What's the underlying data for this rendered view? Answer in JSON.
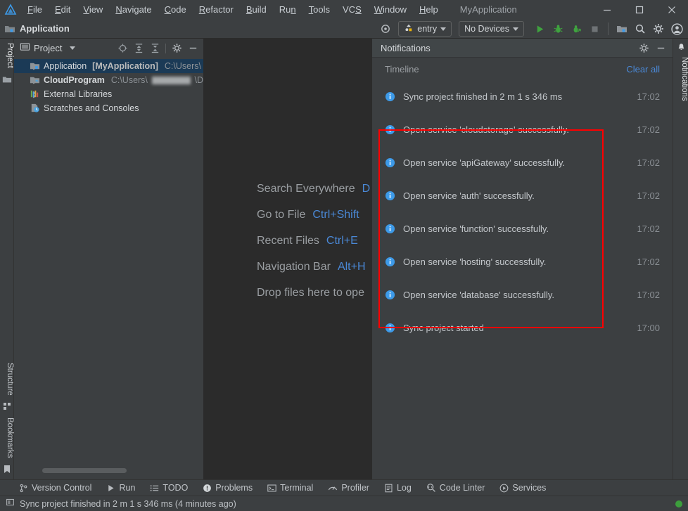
{
  "window": {
    "title": "MyApplication",
    "logo_icon": "ide-logo-icon",
    "minimize_icon": "window-minimize-icon",
    "maximize_icon": "window-maximize-icon",
    "close_icon": "window-close-icon"
  },
  "menubar": {
    "items": [
      {
        "label": "File",
        "mnemonic": "F"
      },
      {
        "label": "Edit",
        "mnemonic": "E"
      },
      {
        "label": "View",
        "mnemonic": "V"
      },
      {
        "label": "Navigate",
        "mnemonic": "N"
      },
      {
        "label": "Code",
        "mnemonic": "C"
      },
      {
        "label": "Refactor",
        "mnemonic": "R"
      },
      {
        "label": "Build",
        "mnemonic": "B"
      },
      {
        "label": "Run",
        "mnemonic": "n"
      },
      {
        "label": "Tools",
        "mnemonic": "T"
      },
      {
        "label": "VCS",
        "mnemonic": "S"
      },
      {
        "label": "Window",
        "mnemonic": "W"
      },
      {
        "label": "Help",
        "mnemonic": "H"
      }
    ]
  },
  "toolbar": {
    "project_label": "Application",
    "project_icon": "module-folder-icon",
    "target_icon": "device-target-icon",
    "run_config": {
      "label": "entry",
      "icon": "entry-module-icon"
    },
    "device_select": {
      "label": "No Devices"
    },
    "run_icon": "run-play-icon",
    "debug_icon": "debug-bug-icon",
    "attach_debug_icon": "attach-debugger-icon",
    "stop_icon": "stop-square-icon",
    "project_structure_icon": "project-structure-icon",
    "search_icon": "search-icon",
    "settings_icon": "gear-icon",
    "account_icon": "account-avatar-icon"
  },
  "left_stripe": {
    "top_tabs": [
      {
        "label": "Project",
        "icon": "project-tab-icon",
        "active": true
      }
    ],
    "top_icons": [
      {
        "icon": "folder-icon"
      }
    ],
    "bottom_tabs": [
      {
        "label": "Structure",
        "icon": "structure-icon"
      },
      {
        "label": "Bookmarks",
        "icon": "bookmark-icon"
      }
    ]
  },
  "project_panel": {
    "title": "Project",
    "title_icon": "project-view-icon",
    "dropdown_icon": "chevron-down-icon",
    "icons": [
      {
        "name": "select-opened-file-icon"
      },
      {
        "name": "expand-all-icon"
      },
      {
        "name": "collapse-all-icon"
      },
      {
        "name": "gear-icon"
      },
      {
        "name": "hide-icon"
      }
    ],
    "tree": [
      {
        "name": "Application",
        "bold_suffix": "[MyApplication]",
        "path": "C:\\Users\\",
        "icon": "module-folder-icon",
        "expandable": true,
        "selected": true,
        "redacted": false
      },
      {
        "name": "CloudProgram",
        "bold_suffix": "",
        "path": "C:\\Users\\",
        "path_suffix": "\\D",
        "icon": "cloud-module-icon",
        "expandable": true,
        "selected": false,
        "redacted": true
      },
      {
        "name": "External Libraries",
        "bold_suffix": "",
        "path": "",
        "icon": "libraries-icon",
        "expandable": true,
        "selected": false,
        "redacted": false
      },
      {
        "name": "Scratches and Consoles",
        "bold_suffix": "",
        "path": "",
        "icon": "scratches-icon",
        "expandable": false,
        "selected": false,
        "redacted": false
      }
    ]
  },
  "editor": {
    "hints": [
      {
        "label": "Search Everywhere",
        "key": "D"
      },
      {
        "label": "Go to File",
        "key": "Ctrl+Shift"
      },
      {
        "label": "Recent Files",
        "key": "Ctrl+E"
      },
      {
        "label": "Navigation Bar",
        "key": "Alt+H"
      },
      {
        "label": "Drop files here to ope",
        "key": ""
      }
    ]
  },
  "notifications": {
    "title": "Notifications",
    "gear_icon": "gear-icon",
    "hide_icon": "hide-icon",
    "timeline_label": "Timeline",
    "clear_all_label": "Clear all",
    "items": [
      {
        "text": "Sync project finished in 2 m 1 s 346 ms",
        "time": "17:02",
        "icon": "info-icon",
        "highlighted": false
      },
      {
        "text": "Open service 'cloudstorage' successfully.",
        "time": "17:02",
        "icon": "info-icon",
        "highlighted": true
      },
      {
        "text": "Open service 'apiGateway' successfully.",
        "time": "17:02",
        "icon": "info-icon",
        "highlighted": true
      },
      {
        "text": "Open service 'auth' successfully.",
        "time": "17:02",
        "icon": "info-icon",
        "highlighted": true
      },
      {
        "text": "Open service 'function' successfully.",
        "time": "17:02",
        "icon": "info-icon",
        "highlighted": true
      },
      {
        "text": "Open service 'hosting' successfully.",
        "time": "17:02",
        "icon": "info-icon",
        "highlighted": true
      },
      {
        "text": "Open service 'database' successfully.",
        "time": "17:02",
        "icon": "info-icon",
        "highlighted": true
      },
      {
        "text": "Sync project started",
        "time": "17:00",
        "icon": "info-icon",
        "highlighted": false
      }
    ],
    "highlight_color": "#ff0000"
  },
  "right_stripe": {
    "tabs": [
      {
        "label": "Notifications",
        "icon": "bell-icon",
        "active": true
      }
    ]
  },
  "bottom_tabs": [
    {
      "label": "Version Control",
      "icon": "branch-icon"
    },
    {
      "label": "Run",
      "icon": "run-play-icon"
    },
    {
      "label": "TODO",
      "icon": "todo-list-icon"
    },
    {
      "label": "Problems",
      "icon": "problems-icon"
    },
    {
      "label": "Terminal",
      "icon": "terminal-icon"
    },
    {
      "label": "Profiler",
      "icon": "profiler-gauge-icon"
    },
    {
      "label": "Log",
      "icon": "log-icon"
    },
    {
      "label": "Code Linter",
      "icon": "code-linter-icon"
    },
    {
      "label": "Services",
      "icon": "services-icon"
    }
  ],
  "statusbar": {
    "icon": "memory-indicator-icon",
    "message": "Sync project finished in 2 m 1 s 346 ms (4 minutes ago)",
    "indicator_color": "#3c9e3c"
  }
}
